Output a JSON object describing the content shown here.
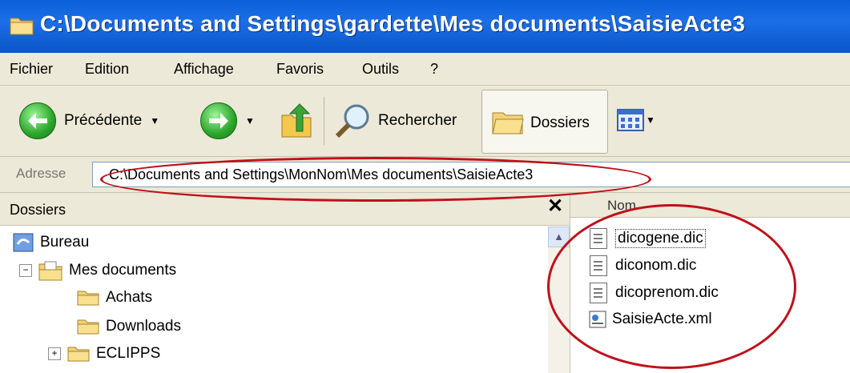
{
  "window": {
    "title": "C:\\Documents and Settings\\gardette\\Mes documents\\SaisieActe3"
  },
  "menu": [
    "Fichier",
    "Edition",
    "Affichage",
    "Favoris",
    "Outils",
    "?"
  ],
  "toolbar": {
    "back_label": "Précédente",
    "search_label": "Rechercher",
    "folders_label": "Dossiers"
  },
  "address": {
    "label": "Adresse",
    "value": "C:\\Documents and Settings\\MonNom\\Mes documents\\SaisieActe3"
  },
  "folders_pane": {
    "title": "Dossiers",
    "close": "✕",
    "tree": [
      {
        "label": "Bureau"
      },
      {
        "label": "Mes documents",
        "expander": "−"
      },
      {
        "label": "Achats"
      },
      {
        "label": "Downloads"
      },
      {
        "label": "ECLIPPS",
        "expander": "+"
      }
    ]
  },
  "files_pane": {
    "column": "Nom",
    "files": [
      "dicogene.dic",
      "diconom.dic",
      "dicoprenom.dic",
      "SaisieActe.xml"
    ]
  },
  "colors": {
    "title_blue": "#0a5fd8",
    "chrome": "#ece9d8",
    "annotation_red": "#c0101a"
  }
}
